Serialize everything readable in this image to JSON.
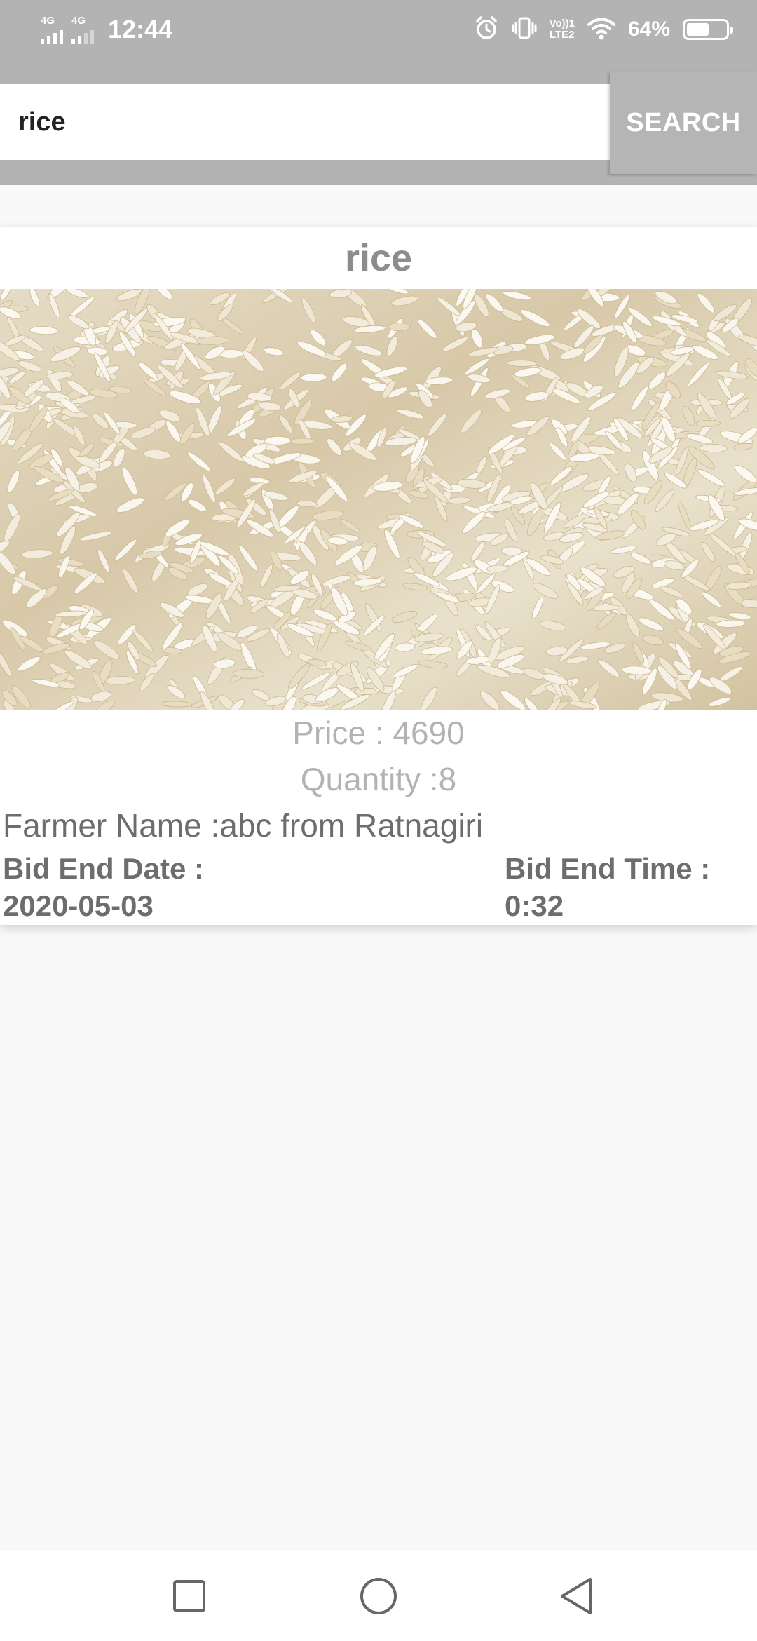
{
  "status_bar": {
    "network_1": "4G",
    "network_2": "4G",
    "time": "12:44",
    "volte_line1": "Vo))1",
    "volte_line2": "LTE2",
    "battery_percent_label": "64%",
    "battery_level": 0.64,
    "icons": [
      "signal-icon",
      "alarm-icon",
      "vibrate-icon",
      "volte-icon",
      "wifi-icon",
      "battery-icon"
    ]
  },
  "search": {
    "value": "rice",
    "button_label": "SEARCH"
  },
  "product": {
    "title": "rice",
    "image": "rice-grains-photo",
    "price": "Price : 4690",
    "quantity": "Quantity :8",
    "farmer": "Farmer Name :abc from Ratnagiri",
    "bid_end_date_label": "Bid End Date :",
    "bid_end_date": "2020-05-03",
    "bid_end_time_label": "Bid End Time :",
    "bid_end_time": "0:32"
  },
  "nav": {
    "icons": [
      "recent-apps-icon",
      "home-icon",
      "back-icon"
    ]
  },
  "colors": {
    "status_bar": "#b3b3b3",
    "search_button": "#b5b5b5",
    "title_text": "#8c8c8c",
    "muted_text": "#b3b3b3",
    "body_text": "#6d6d6d",
    "background": "#f9f9f9"
  }
}
